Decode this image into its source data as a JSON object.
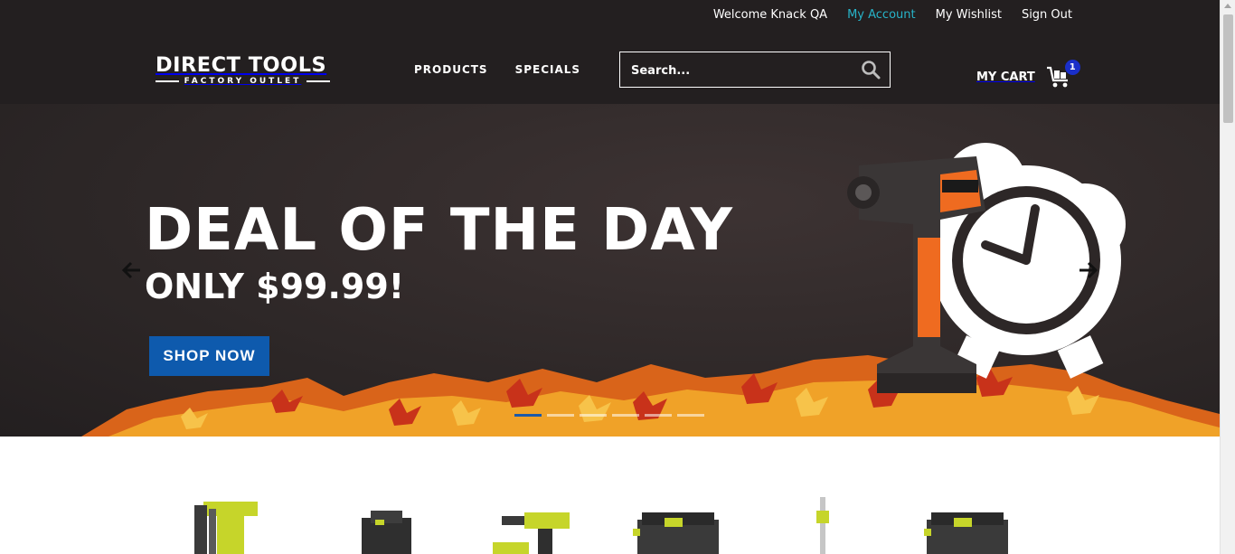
{
  "topbar": {
    "welcome": "Welcome Knack QA",
    "account": "My Account",
    "wishlist": "My Wishlist",
    "signout": "Sign Out"
  },
  "logo": {
    "main": "DIRECT TOOLS",
    "sub": "FACTORY OUTLET"
  },
  "nav": {
    "products": "PRODUCTS",
    "specials": "SPECIALS"
  },
  "search": {
    "placeholder": "Search..."
  },
  "cart": {
    "label": "MY CART",
    "count": "1"
  },
  "hero": {
    "title": "DEAL OF THE DAY",
    "subtitle": "ONLY $99.99!",
    "cta": "SHOP NOW",
    "slide_count": 6,
    "active_slide": 1
  },
  "products": [
    {
      "icon": "nailer-icon"
    },
    {
      "icon": "battery-icon"
    },
    {
      "icon": "drill-kit-icon"
    },
    {
      "icon": "wet-dry-vac-icon"
    },
    {
      "icon": "string-trimmer-icon"
    },
    {
      "icon": "wet-dry-vac-icon"
    }
  ],
  "colors": {
    "header_bg": "#231f20",
    "accent_link": "#27b4c9",
    "cta_blue": "#0e5aad",
    "badge_blue": "#1a2fc9",
    "ryobi_green": "#c6d52a"
  }
}
